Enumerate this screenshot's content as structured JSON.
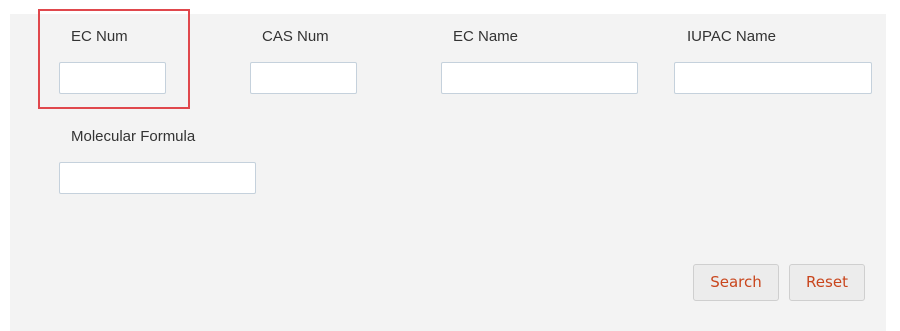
{
  "form": {
    "fields": {
      "ec_num": {
        "label": "EC Num",
        "value": ""
      },
      "cas_num": {
        "label": "CAS Num",
        "value": ""
      },
      "ec_name": {
        "label": "EC Name",
        "value": ""
      },
      "iupac_name": {
        "label": "IUPAC Name",
        "value": ""
      },
      "molecular_formula": {
        "label": "Molecular Formula",
        "value": ""
      }
    },
    "buttons": {
      "search_label": "Search",
      "reset_label": "Reset"
    }
  },
  "colors": {
    "panel_background": "#f3f3f3",
    "highlight_border": "#e0474c",
    "button_text": "#c9461d",
    "input_border": "#c5d1dc"
  }
}
